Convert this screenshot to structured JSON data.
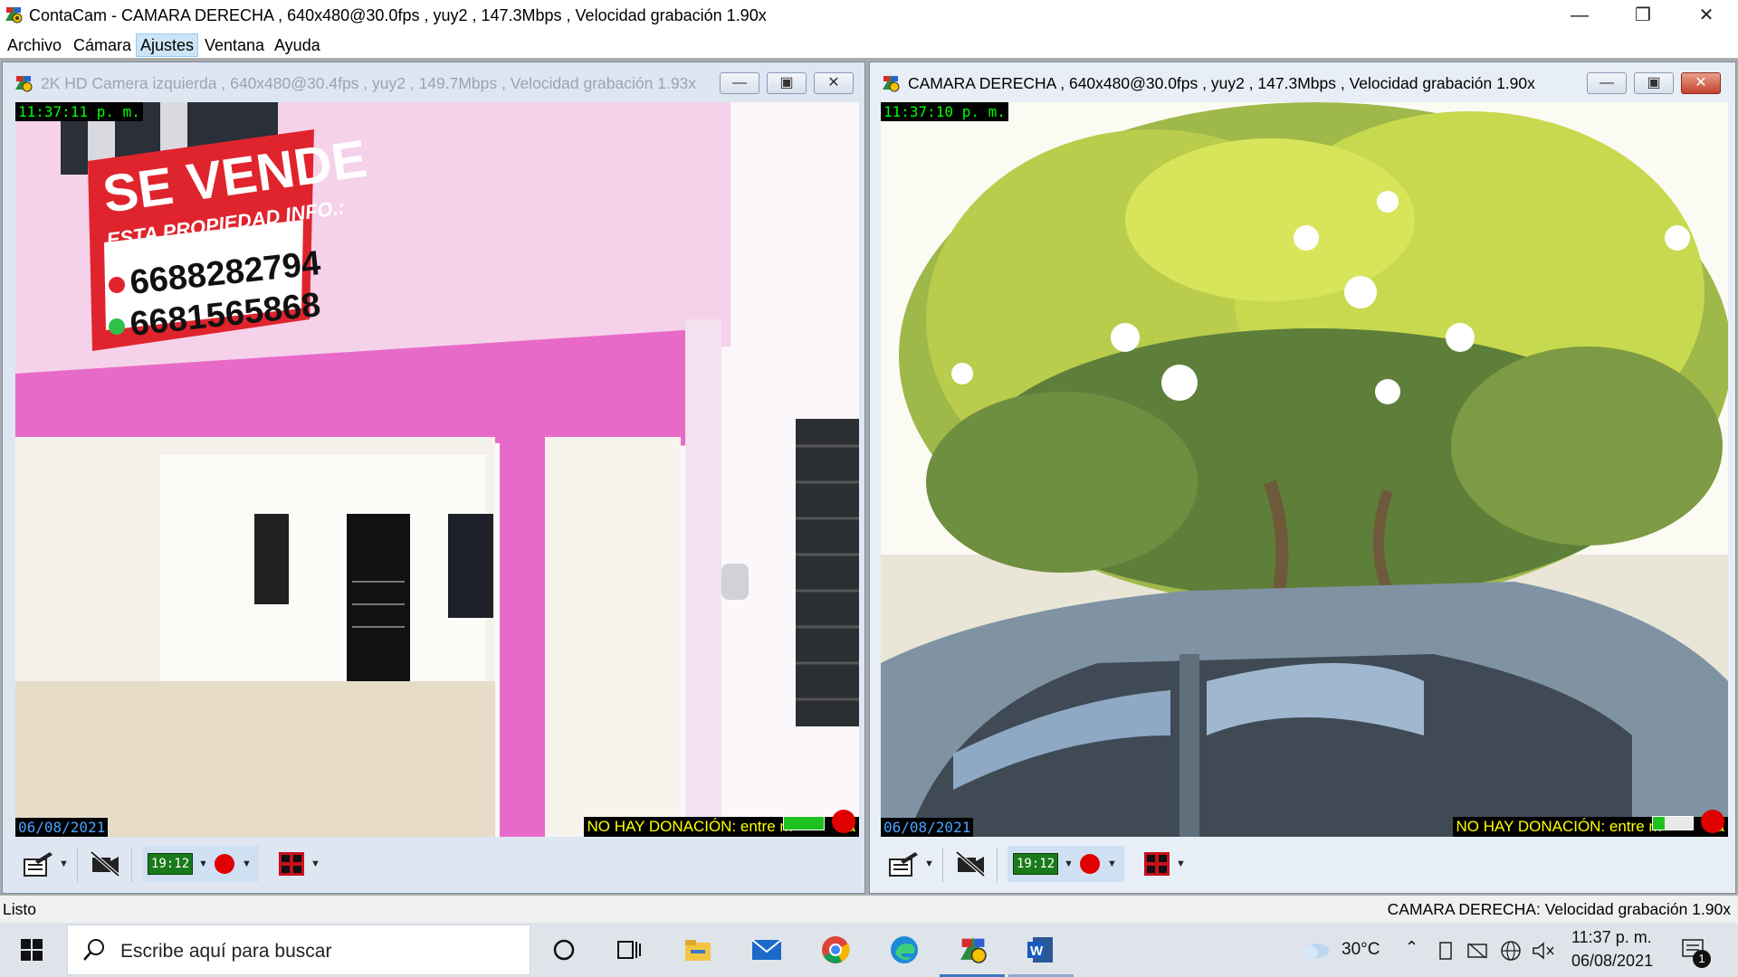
{
  "window": {
    "title": "ContaCam - CAMARA DERECHA , 640x480@30.0fps , yuy2 , 147.3Mbps , Velocidad grabación 1.90x",
    "minimize_symbol": "—",
    "maximize_symbol": "❐",
    "close_symbol": "✕"
  },
  "menu": {
    "items": [
      "Archivo",
      "Cámara",
      "Ajustes",
      "Ventana",
      "Ayuda"
    ],
    "active": "Ajustes"
  },
  "cameras": [
    {
      "title": "2K HD Camera izquierda , 640x480@30.4fps , yuy2 , 149.7Mbps , Velocidad grabación 1.93x",
      "time": "11:37:11 p. m.",
      "date": "06/08/2021",
      "donation": "NO HAY DONACIÓN: entre m",
      "donation_tail": "a",
      "sign": {
        "line1": "SE VENDE",
        "line2": "ESTA PROPIEDAD INFO.:",
        "phone1": "6688282794",
        "phone2": "6681565868"
      },
      "toolbar": {
        "clock_badge": "19:12"
      },
      "active": false
    },
    {
      "title": "CAMARA DERECHA , 640x480@30.0fps , yuy2 , 147.3Mbps , Velocidad grabación 1.90x",
      "time": "11:37:10 p. m.",
      "date": "06/08/2021",
      "donation": "NO HAY DONACIÓN: entre m",
      "donation_tail": "a",
      "toolbar": {
        "clock_badge": "19:12"
      },
      "active": true
    }
  ],
  "status": {
    "left": "Listo",
    "right": "CAMARA DERECHA: Velocidad grabación 1.90x"
  },
  "taskbar": {
    "search_placeholder": "Escribe aquí para buscar",
    "icons": [
      "windows-start-icon",
      "cortana-icon",
      "task-view-icon",
      "file-explorer-icon",
      "mail-icon",
      "chrome-icon",
      "edge-icon",
      "contacam-icon",
      "word-icon"
    ],
    "weather": "30°C",
    "time": "11:37 p. m.",
    "date": "06/08/2021",
    "notification_count": "1"
  },
  "colors": {
    "accent": "#3b78c3",
    "timestamp_green": "#00ff00",
    "date_blue": "#4aa3ff",
    "donation_yellow": "#ffff00",
    "record_red": "#e00000",
    "wall_pink": "#e86ac8"
  }
}
